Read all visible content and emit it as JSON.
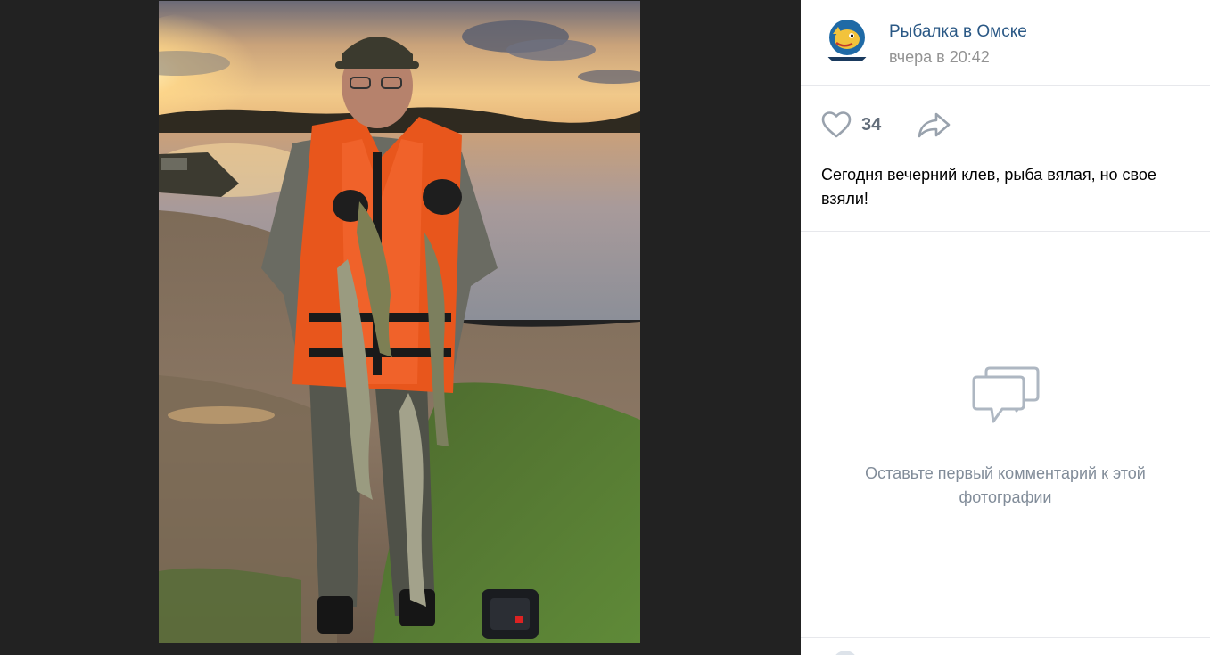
{
  "post": {
    "author_name": "Рыбалка в Омске",
    "time": "вчера в 20:42",
    "likes": "34",
    "caption": "Сегодня вечерний клев, рыба вялая, но свое взяли!"
  },
  "comments": {
    "empty_text": "Оставьте первый комментарий к этой фотографии"
  },
  "icons": {
    "like": "heart-icon",
    "share": "share-arrow-icon",
    "comments": "speech-bubbles-icon"
  },
  "colors": {
    "link": "#2a5885",
    "muted": "#818c99",
    "background": "#222222",
    "icon": "#99a2ad"
  }
}
